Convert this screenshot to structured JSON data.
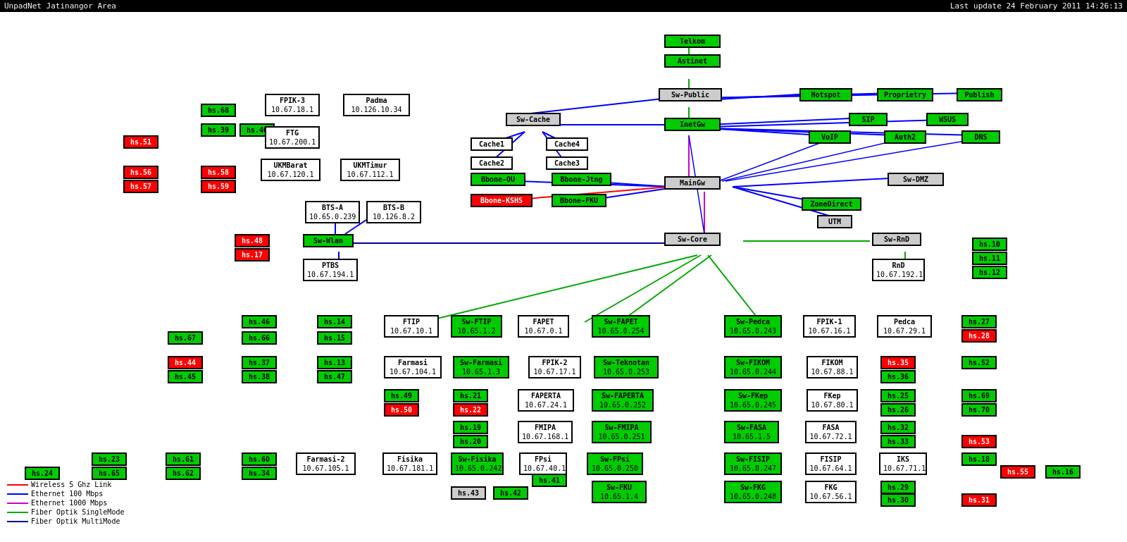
{
  "header": {
    "title": "UnpadNet Jatinangor Area",
    "last_update": "Last update 24 February 2011 14:26:13"
  },
  "legend": {
    "items": [
      {
        "label": "Wireless 5 Ghz Link",
        "color": "#ff0000"
      },
      {
        "label": "Ethernet 100 Mbps",
        "color": "#0000ff"
      },
      {
        "label": "Ethernet 1000 Mbps",
        "color": "#cc00cc"
      },
      {
        "label": "Fiber Optik SingleMode",
        "color": "#00aa00"
      },
      {
        "label": "Fiber Optik MultiMode",
        "color": "#000099"
      }
    ]
  }
}
